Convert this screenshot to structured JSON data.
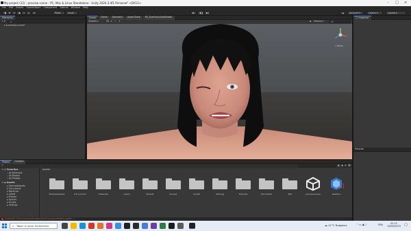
{
  "window": {
    "title": "My project (12) - preview scene - PC, Mac & Linux Standalone - Unity 2020.3.4f1 Personal* <DX11>"
  },
  "menu": [
    "File",
    "Edit",
    "Assets",
    "GameObject",
    "Component",
    "Tutorial",
    "Window",
    "Help"
  ],
  "toolbar": {
    "pivot": "Pivot",
    "local": "Local",
    "account": "Account",
    "layers": "Layers",
    "layout": "Layout"
  },
  "hierarchy": {
    "tab": "Hierarchy",
    "search_placeholder": "All",
    "scene": "preview scene*"
  },
  "scene_view": {
    "tabs": [
      "Scene",
      "Game",
      "Animator",
      "Asset Store",
      "RC_EyeOcclusionShader"
    ],
    "shading": "Shaded",
    "mode": "2D",
    "gizmos": "Gizmos",
    "search_placeholder": "All",
    "persp": "< Persp"
  },
  "inspector": {
    "tab": "Inspector"
  },
  "preview": {
    "label": "Preview"
  },
  "project": {
    "tabs": [
      "Project",
      "Console"
    ],
    "create": "+",
    "breadcrumb": "Assets",
    "favorites_label": "Favorites",
    "favorites": [
      "All Materials",
      "All Models",
      "All Prefabs"
    ],
    "assets_label": "Assets",
    "tree": [
      "ExampleAssets",
      "full product",
      "Materials",
      "naked",
      "Presets",
      "Scenes",
      "Scripts",
      "Settings"
    ],
    "assets": [
      {
        "name": "ExampleAssets",
        "kind": "folder"
      },
      {
        "name": "full product",
        "kind": "folder"
      },
      {
        "name": "Materials",
        "kind": "folder"
      },
      {
        "name": "naked",
        "kind": "folder"
      },
      {
        "name": "Presets",
        "kind": "folder"
      },
      {
        "name": "Scenes",
        "kind": "folder"
      },
      {
        "name": "Scripts",
        "kind": "folder"
      },
      {
        "name": "Settings",
        "kind": "folder"
      },
      {
        "name": "Textures",
        "kind": "folder"
      },
      {
        "name": "TutorialInfo",
        "kind": "folder"
      },
      {
        "name": "URP",
        "kind": "folder"
      },
      {
        "name": "preview scene",
        "kind": "unity"
      },
      {
        "name": "Readme",
        "kind": "readme"
      }
    ]
  },
  "status_bar": {
    "message": "Assets/RC_EyeOcclusion/Shaders/EyeOcclusionShader.shader: ..."
  },
  "taskbar": {
    "search_placeholder": "Taper ici pour rechercher",
    "weather": "11°C  Nuageux",
    "lang": "FRA",
    "time": "02:15",
    "date": "15/05/2023"
  },
  "colors": {
    "accent": "#5a8ae8",
    "editor_bg": "#383838",
    "skin": "#d49a86",
    "hair": "#0e0e0e"
  }
}
